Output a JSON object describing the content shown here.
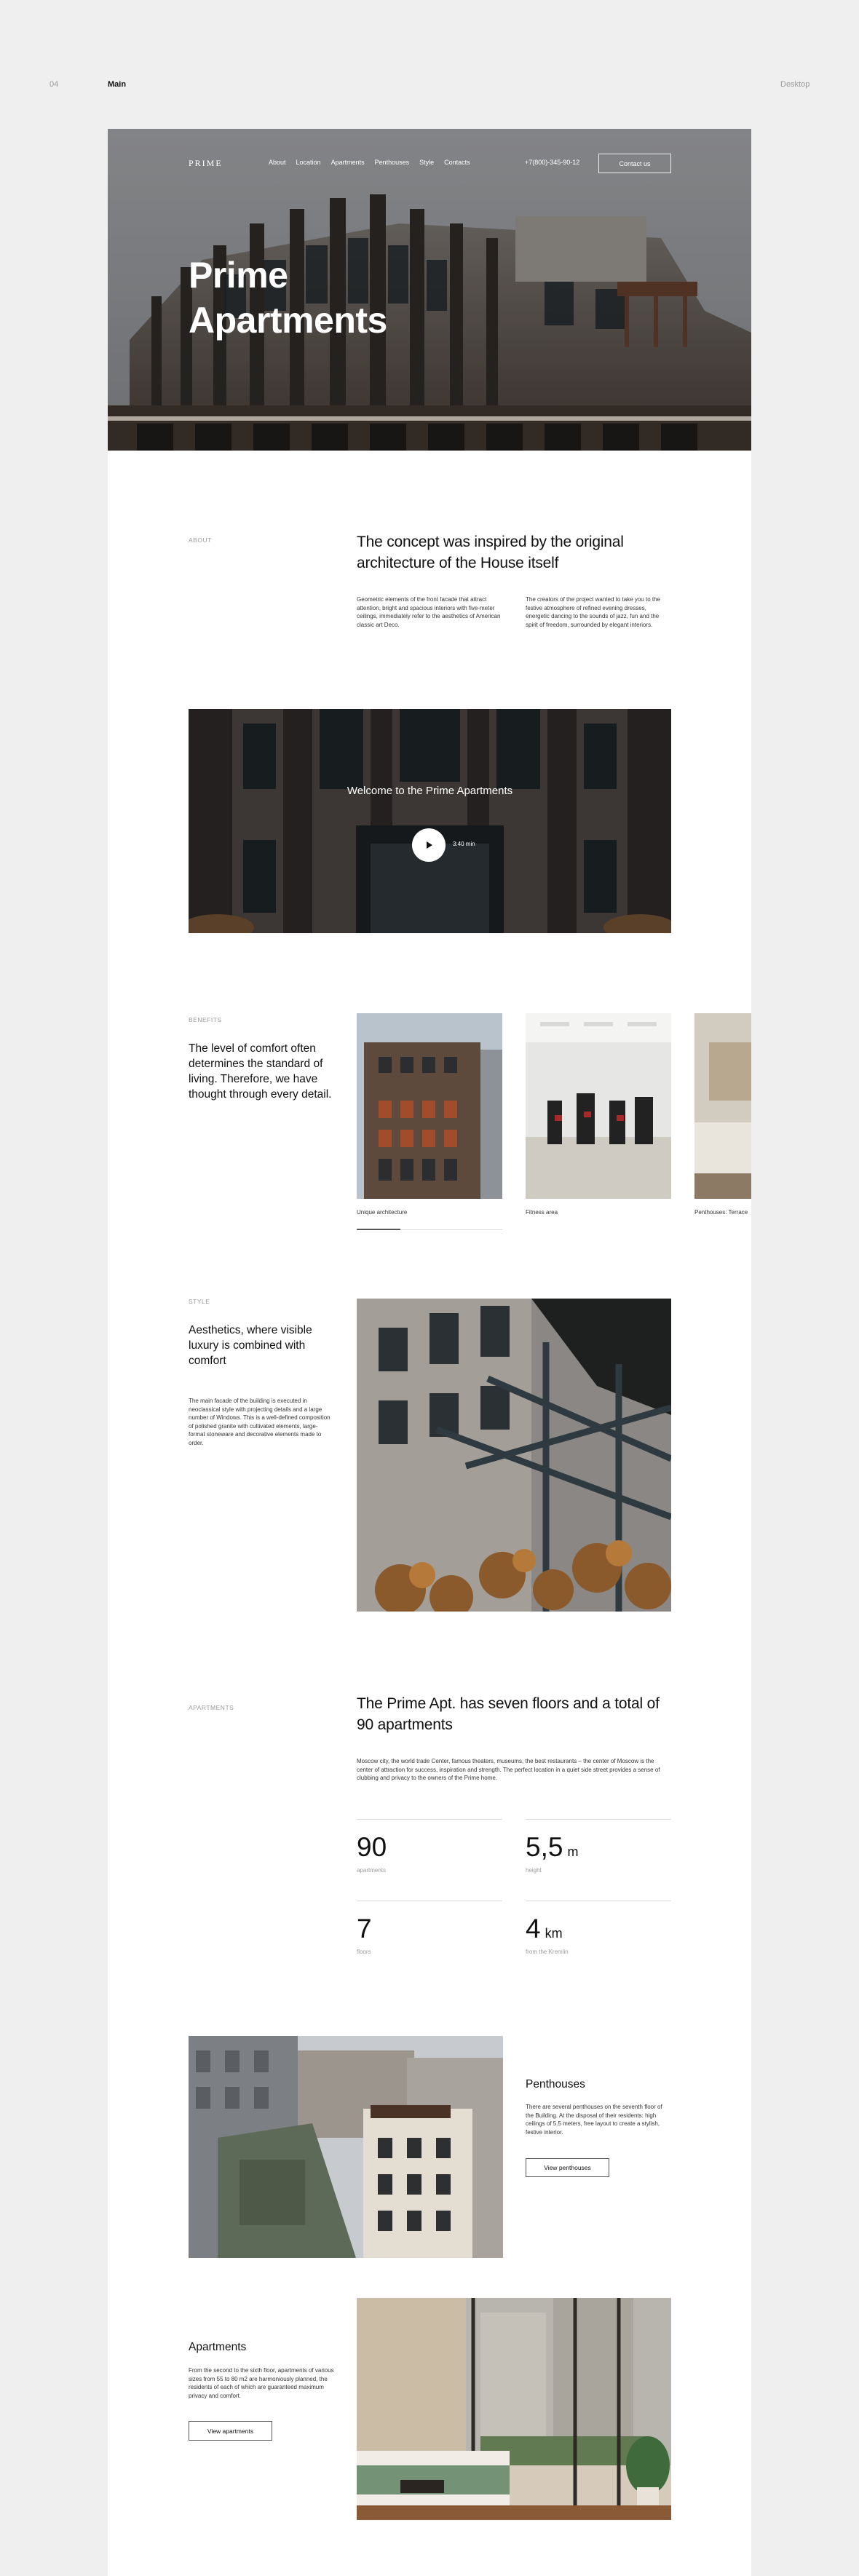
{
  "presentation": {
    "number": "04",
    "page_name": "Main",
    "view": "Desktop"
  },
  "nav": {
    "logo": "PRIME",
    "links": [
      "About",
      "Location",
      "Apartments",
      "Penthouses",
      "Style",
      "Contacts"
    ],
    "phone": "+7(800)-345-90-12",
    "contact_button": "Contact us"
  },
  "hero": {
    "title_line1": "Prime",
    "title_line2": "Apartments"
  },
  "about": {
    "label": "ABOUT",
    "heading": "The concept was inspired by the original architecture of the House itself",
    "col1": "Geometric elements of the front facade that attract attention, bright and spacious interiors with five-meter ceilings, immediately refer to the aesthetics of American classic art Deco.",
    "col2": "The creators of the project wanted to take you to the festive atmosphere of refined evening dresses, energetic dancing to the sounds of jazz, fun and the spirit of freedom, surrounded by elegant interiors."
  },
  "video": {
    "title": "Welcome to the Prime Apartments",
    "duration": "3:40 min"
  },
  "benefits": {
    "label": "BENEFITS",
    "heading": "The level of comfort often determines the standard of living. Therefore, we have thought through every detail.",
    "cards": [
      {
        "caption": "Unique architecture"
      },
      {
        "caption": "Fitness area"
      },
      {
        "caption": "Penthouses: Terrace"
      }
    ],
    "progress": 0.3
  },
  "style": {
    "label": "STYLE",
    "heading": "Aesthetics, where visible luxury is combined with comfort",
    "text": "The main facade of the building is executed in neoclassical style with projecting details and a large number of Windows. This is a well-defined composition of polished granite with cultivated elements, large-format stoneware and decorative elements made to order."
  },
  "apartments_info": {
    "label": "APARTMENTS",
    "heading": "The Prime Apt. has seven floors and a total of 90 apartments",
    "text": "Moscow city, the world trade Center, famous theaters, museums, the best restaurants – the center of Moscow is the center of attraction for success, inspiration and strength. The perfect location in a quiet side street provides a sense of clubbing and privacy to the owners of the Prime home.",
    "stats": [
      {
        "value": "90",
        "unit": "",
        "label": "apartments"
      },
      {
        "value": "5,5",
        "unit": "m",
        "label": "height"
      },
      {
        "value": "7",
        "unit": "",
        "label": "floors"
      },
      {
        "value": "4",
        "unit": "km",
        "label": "from the Kremlin"
      }
    ]
  },
  "penthouses": {
    "heading": "Penthouses",
    "text": "There are several penthouses on the seventh floor of the Building. At the disposal of their residents: high ceilings of 5.5 meters, free layout to create a stylish, festive interior.",
    "button": "View penthouses"
  },
  "apartments_block": {
    "heading": "Apartments",
    "text": "From the second to the sixth floor, apartments of various sizes from 55 to 80 m2 are harmoniously planned, the residents of each of which are guaranteed maximum privacy and comfort.",
    "button": "View apartments"
  }
}
